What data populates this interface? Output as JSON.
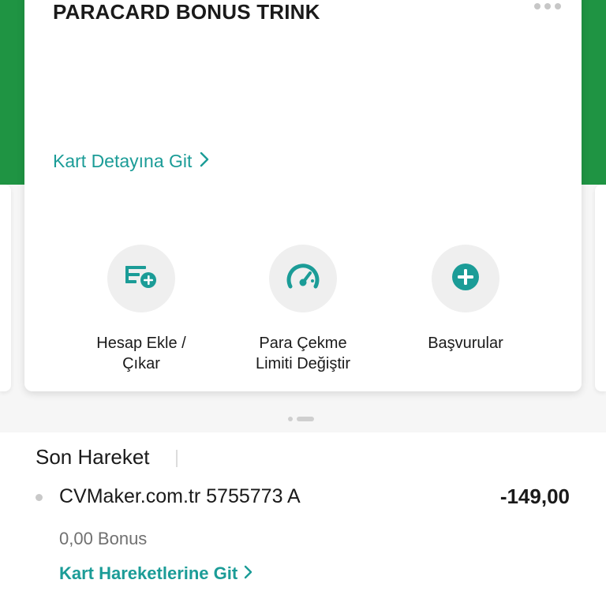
{
  "card": {
    "title": "PARACARD BONUS TRINK",
    "detail_link": "Kart Detayına Git"
  },
  "actions": [
    {
      "label": "Hesap Ekle /\nÇıkar",
      "icon": "account-add-icon"
    },
    {
      "label": "Para Çekme\nLimiti Değiştir",
      "icon": "speedometer-icon"
    },
    {
      "label": "Başvurular",
      "icon": "plus-circle-icon"
    }
  ],
  "recent": {
    "title": "Son Hareket",
    "transaction": {
      "name": "CVMaker.com.tr 5755773 A",
      "amount": "-149,00",
      "bonus": "0,00 Bonus"
    },
    "link": "Kart Hareketlerine Git"
  },
  "colors": {
    "brand_green": "#1f9443",
    "accent_teal": "#1b9c97"
  }
}
